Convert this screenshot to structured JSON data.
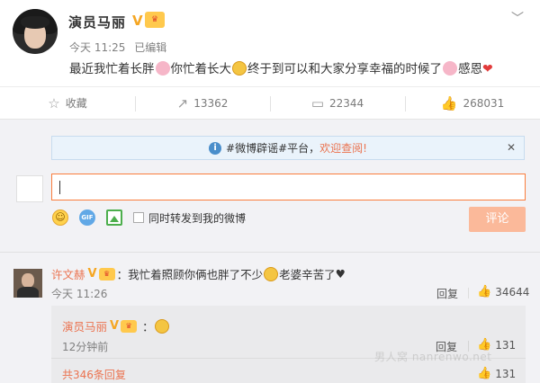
{
  "post": {
    "author": "演员马丽",
    "verified_mark": "V",
    "time": "今天 11:25",
    "edited": "已编辑",
    "content_parts": [
      "最近我忙着长胖",
      "你忙着长大",
      "终于到可以和大家分享幸福的时候了",
      "感恩"
    ]
  },
  "actions": {
    "favorite": "收藏",
    "repost": "13362",
    "comment": "22344",
    "like": "268031"
  },
  "composer": {
    "notice_prefix": "#微博辟谣#平台，",
    "notice_link": "欢迎查阅!",
    "sync_label": "同时转发到我的微博",
    "submit_label": "评论"
  },
  "comment": {
    "author": "许文赫",
    "verified_mark": "V",
    "text_a": "：我忙着照顾你俩也胖了不少",
    "text_b": "老婆辛苦了",
    "time": "今天 11:26",
    "reply_label": "回复",
    "likes": "34644",
    "sub_reply": {
      "author": "演员马丽",
      "verified_mark": "V",
      "time": "12分钟前",
      "reply_label": "回复",
      "likes": "131"
    },
    "more_replies": "共346条回复",
    "more_likes": "131"
  },
  "watermark": "男人窝 nanrenwo.net",
  "colors": {
    "accent": "#eb7350",
    "verified": "#f5a623",
    "panel": "#f2f2f5"
  }
}
